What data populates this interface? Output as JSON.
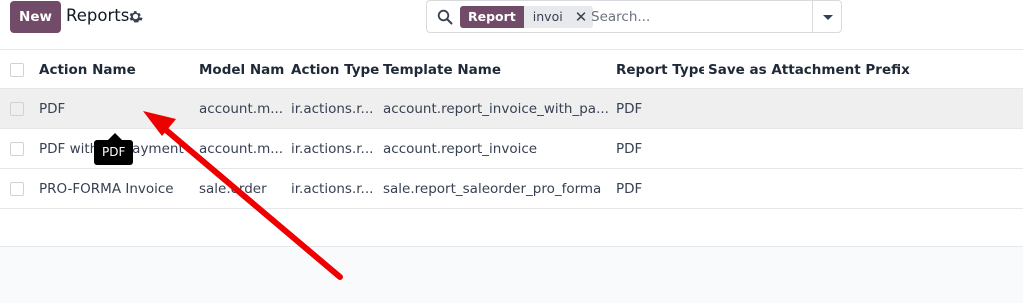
{
  "header": {
    "new_label": "New",
    "title": "Reports",
    "settings_icon": "gear-icon"
  },
  "search": {
    "facet_label": "Report",
    "facet_value": "invoi",
    "placeholder": "Search...",
    "icon": "search-icon"
  },
  "table": {
    "columns": [
      "Action Name",
      "Model Name",
      "Action Type",
      "Template Name",
      "Report Type",
      "Save as Attachment Prefix"
    ],
    "rows": [
      {
        "action_name": "PDF",
        "model_name": "account.m...",
        "action_type": "ir.actions.r...",
        "template_name": "account.report_invoice_with_pa...",
        "report_type": "PDF",
        "attachment_prefix": ""
      },
      {
        "action_name": "PDF without Payment",
        "model_name": "account.m...",
        "action_type": "ir.actions.r...",
        "template_name": "account.report_invoice",
        "report_type": "PDF",
        "attachment_prefix": ""
      },
      {
        "action_name": "PRO-FORMA Invoice",
        "model_name": "sale.order",
        "action_type": "ir.actions.r...",
        "template_name": "sale.report_saleorder_pro_forma",
        "report_type": "PDF",
        "attachment_prefix": ""
      }
    ]
  },
  "tooltip": {
    "text": "PDF"
  },
  "colors": {
    "brand": "#714b67",
    "annotation_arrow": "#ee0000"
  }
}
